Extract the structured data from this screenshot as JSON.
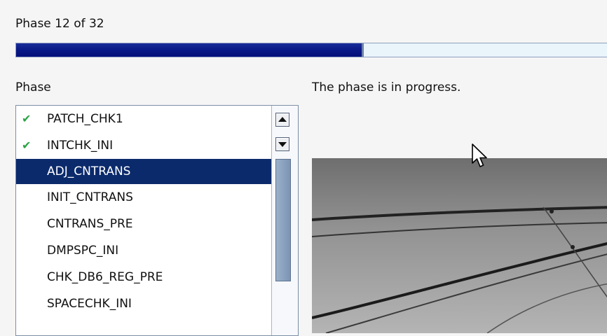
{
  "header": {
    "phase_count": "Phase 12 of 32",
    "progress_percent": 57.5,
    "progress_color": "#0a1a88"
  },
  "phase_list": {
    "label": "Phase",
    "items": [
      {
        "label": "PATCH_CHK1",
        "status": "done",
        "icon": "check-icon"
      },
      {
        "label": "INTCHK_INI",
        "status": "done",
        "icon": "check-icon"
      },
      {
        "label": "ADJ_CNTRANS",
        "status": "selected"
      },
      {
        "label": "INIT_CNTRANS"
      },
      {
        "label": "CNTRANS_PRE"
      },
      {
        "label": "DMPSPC_INI"
      },
      {
        "label": "CHK_DB6_REG_PRE"
      },
      {
        "label": "SPACECHK_INI"
      }
    ],
    "check_glyph": "✔",
    "selection_color": "#0b2a6b"
  },
  "status": {
    "text": "The phase is in progress."
  }
}
